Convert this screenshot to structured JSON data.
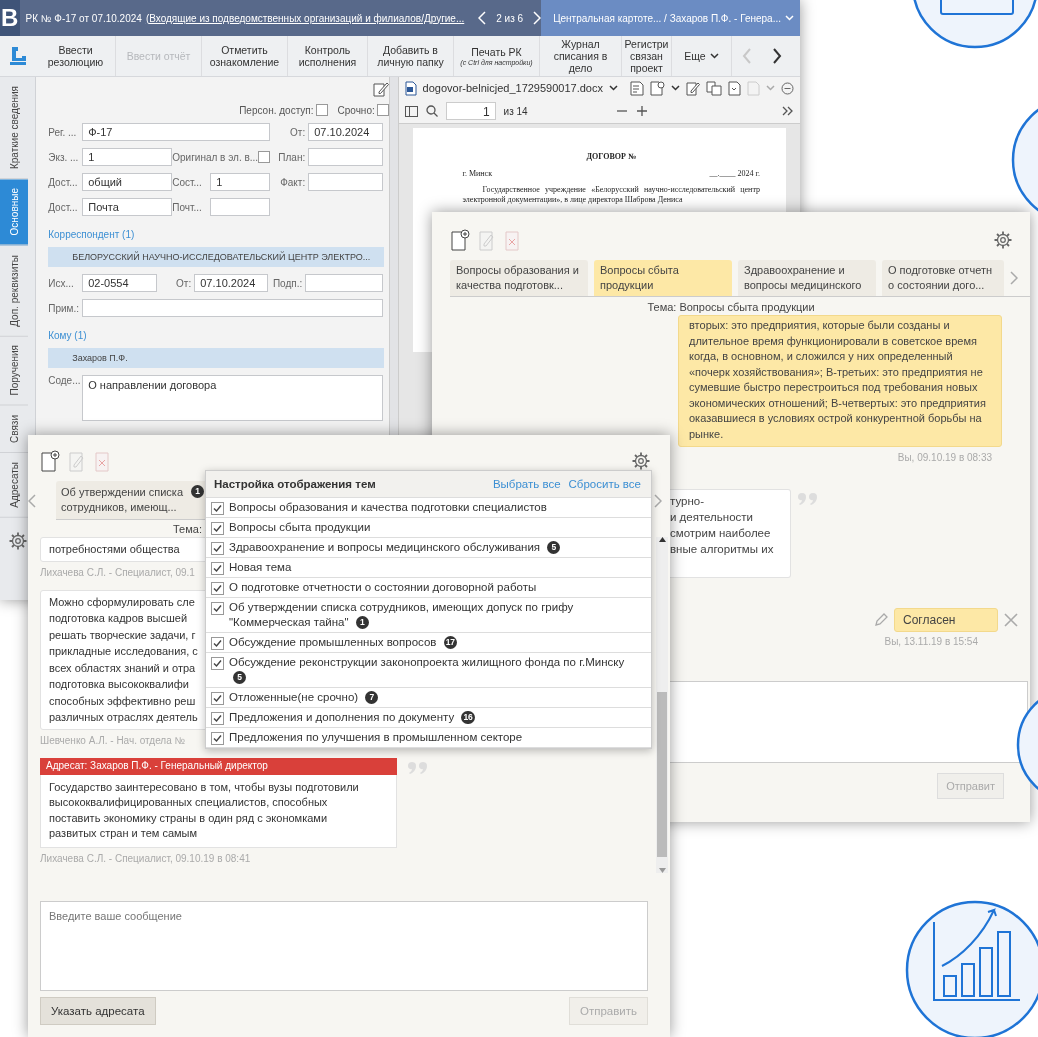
{
  "back_window": {
    "logo": "B",
    "title": "РК № Ф-17 от 07.10.2024",
    "title_link": "(Входящие из подведомственных организаций и филиалов/Другие...",
    "pager": "2 из 6",
    "breadcrumb": "Центральная картоте... / Захаров П.Ф. - Генера...",
    "toolbar": [
      {
        "kind": "button",
        "label": "Ввести резолюцию",
        "disabled": false
      },
      {
        "kind": "button",
        "label": "Ввести отчёт",
        "disabled": true
      },
      {
        "kind": "button",
        "label": "Отметить ознакомление",
        "disabled": false
      },
      {
        "kind": "button",
        "label": "Контроль исполнения",
        "disabled": false
      },
      {
        "kind": "button",
        "label": "Добавить в личную папку",
        "disabled": false
      },
      {
        "kind": "button",
        "label": "Печать РК",
        "note": "(с Ctrl для настройки)",
        "disabled": false
      },
      {
        "kind": "button",
        "label": "Журнал списания в дело",
        "disabled": false
      },
      {
        "kind": "button",
        "label": "Регистри связан проект",
        "disabled": false
      },
      {
        "kind": "menu",
        "label": "Еще",
        "disabled": false
      }
    ],
    "nav": [
      {
        "disabled": true
      },
      {
        "disabled": false
      }
    ],
    "side_tabs": [
      {
        "label": "Краткие сведения",
        "selected": false
      },
      {
        "label": "Основные",
        "selected": true
      },
      {
        "label": "Доп. реквизиты",
        "selected": false
      },
      {
        "label": "Поручения",
        "selected": false
      },
      {
        "label": "Связи",
        "selected": false
      },
      {
        "label": "Адресаты",
        "selected": false
      }
    ],
    "form": {
      "flags": [
        {
          "label": "Персон. доступ:",
          "checked": false
        },
        {
          "label": "Срочно:",
          "checked": false
        }
      ],
      "rows": [
        {
          "kind": "fields",
          "cells": [
            {
              "kind": "label",
              "text": "Рег. ..."
            },
            {
              "kind": "input",
              "value": "Ф-17"
            },
            {
              "kind": "label",
              "text": "От:"
            },
            {
              "kind": "input",
              "value": "07.10.2024"
            }
          ]
        },
        {
          "kind": "fields",
          "cells": [
            {
              "kind": "label",
              "text": "Экз. ..."
            },
            {
              "kind": "input",
              "value": "1"
            },
            {
              "kind": "label",
              "text": "Оригинал в эл. в..."
            },
            {
              "kind": "checkbox",
              "checked": false
            },
            {
              "kind": "label",
              "text": "План:"
            },
            {
              "kind": "input"
            }
          ]
        },
        {
          "kind": "fields",
          "cells": [
            {
              "kind": "label",
              "text": "Дост..."
            },
            {
              "kind": "input",
              "value": "общий"
            },
            {
              "kind": "label",
              "text": "Сост..."
            },
            {
              "kind": "input",
              "value": "1"
            },
            {
              "kind": "label",
              "text": "Факт:"
            },
            {
              "kind": "input"
            }
          ]
        },
        {
          "kind": "fields",
          "cells": [
            {
              "kind": "label",
              "text": "Дост..."
            },
            {
              "kind": "input",
              "value": "Почта"
            },
            {
              "kind": "label",
              "text": "Почт..."
            },
            {
              "kind": "input"
            }
          ]
        },
        {
          "kind": "heading",
          "text": "Корреспондент (1)"
        },
        {
          "kind": "entity",
          "text": "БЕЛОРУССКИЙ НАУЧНО-ИССЛЕДОВАТЕЛЬСКИЙ ЦЕНТР ЭЛЕКТРО..."
        },
        {
          "kind": "fields",
          "cells": [
            {
              "kind": "label",
              "text": "Исх..."
            },
            {
              "kind": "input",
              "value": "02-0554"
            },
            {
              "kind": "label",
              "text": "От:"
            },
            {
              "kind": "input",
              "value": "07.10.2024"
            },
            {
              "kind": "label",
              "text": "Подп.:"
            },
            {
              "kind": "input"
            }
          ]
        },
        {
          "kind": "fields",
          "cells": [
            {
              "kind": "label",
              "text": "Прим.:"
            },
            {
              "kind": "input"
            }
          ]
        },
        {
          "kind": "heading",
          "text": "Кому (1)"
        },
        {
          "kind": "entity",
          "text": "Захаров П.Ф."
        },
        {
          "kind": "textarea",
          "label": "Соде...",
          "value": "О направлении договора"
        }
      ]
    },
    "viewer": {
      "file": "dogovor-belnicjed_1729590017.docx",
      "page": "1",
      "pages": "из 14",
      "doc_title": "ДОГОВОР №",
      "city": "г. Минск",
      "date": "__.____ 2024 г.",
      "paragraph": "Государственное учреждение «Белорусский научно-исследовательский центр электронной документации», в лице директора Шаброва Дениса"
    }
  },
  "topics_window": {
    "tabs": [
      {
        "label": "Вопросы образования и\nкачества подготовк...",
        "selected": false
      },
      {
        "label": "Вопросы сбыта\nпродукции",
        "selected": true
      },
      {
        "label": "Здравоохранение и\nвопросы медицинского",
        "selected": false
      },
      {
        "label": "О подготовке отчетн\nо состоянии дого...",
        "selected": false
      }
    ],
    "topic": "Тема: Вопросы сбыта продукции",
    "messages": [
      {
        "kind": "own",
        "text": "вторых: это предприятия, которые были созданы и длительное время функционировали в советское время когда, в основном, и сложился у них определенный «почерк хозяйствования»; В-третьих: это предприятия не сумевшие быстро перестроиться под требования новых экономических отношений; В-четвертых: это предприятия оказавшиеся в условиях острой конкурентной борьбы на рынке.",
        "meta": "Вы, 09.10.19 в 08:33"
      },
      {
        "kind": "fragment",
        "text": "турно-\nи деятельности\nсмотрим наиболее\nвные алгоритмы их"
      },
      {
        "kind": "own_short",
        "text": "Согласен",
        "meta": "Вы, 13.11.19 в 15:54"
      }
    ],
    "send": "Отправит"
  },
  "chat_window": {
    "tab": {
      "label": "Об утверждении списка\nсотрудников, имеющ...",
      "count": "1"
    },
    "topic": "Тема:",
    "messages": [
      {
        "kind": "fragment",
        "text": "потребностями общества",
        "meta": "Лихачева С.Л. - Специалист, 09.1"
      },
      {
        "kind": "fragment",
        "text": "Можно сформулировать сле\nподготовка кадров высшей\nрешать творческие задачи, г\nприкладные исследования, с\nвсех областях знаний и отра\nподготовка высококвалифи\nспособных эффективно реш\nразличных отраслях деятель",
        "meta": "Шевченко А.Л. - Нач. отдела №"
      },
      {
        "kind": "addressed",
        "addressee": "Адресат: Захаров П.Ф. - Генеральный директор",
        "text": "Государство заинтересовано в том, чтобы вузы подготовили высококвалифицированных специалистов, способных поставить экономику страны в один ряд с экономками развитых стран и тем самым",
        "meta": "Лихачева С.Л. - Специалист, 09.10.19 в 08:41"
      }
    ],
    "placeholder": "Введите ваше сообщение",
    "buttons": [
      {
        "label": "Указать адресата",
        "disabled": false
      },
      {
        "label": "Отправить",
        "disabled": true
      }
    ],
    "topic_settings": {
      "title": "Настройка отображения тем",
      "select_all": "Выбрать все",
      "reset_all": "Сбросить все",
      "items": [
        {
          "label": "Вопросы образования и качества подготовки специалистов",
          "checked": true
        },
        {
          "label": "Вопросы сбыта продукции",
          "checked": true
        },
        {
          "label": "Здравоохранение и вопросы медицинского обслуживания",
          "checked": true,
          "count": "5"
        },
        {
          "label": "Новая тема",
          "checked": true
        },
        {
          "label": "О подготовке отчетности о состоянии договорной работы",
          "checked": true
        },
        {
          "label": "Об утверждении списка сотрудников, имеющих допуск по грифу \"Коммерческая тайна\"",
          "checked": true,
          "count": "1"
        },
        {
          "label": "Обсуждение промышленных вопросов",
          "checked": true,
          "count": "17"
        },
        {
          "label": "Обсуждение реконструкции законопроекта жилищного фонда по г.Минску",
          "checked": true,
          "count": "5"
        },
        {
          "label": "Отложенные(не срочно)",
          "checked": true,
          "count": "7"
        },
        {
          "label": "Предложения и дополнения по документу",
          "checked": true,
          "count": "16"
        },
        {
          "label": "Предложения по улучшения в промышленном секторе",
          "checked": true
        }
      ]
    }
  }
}
